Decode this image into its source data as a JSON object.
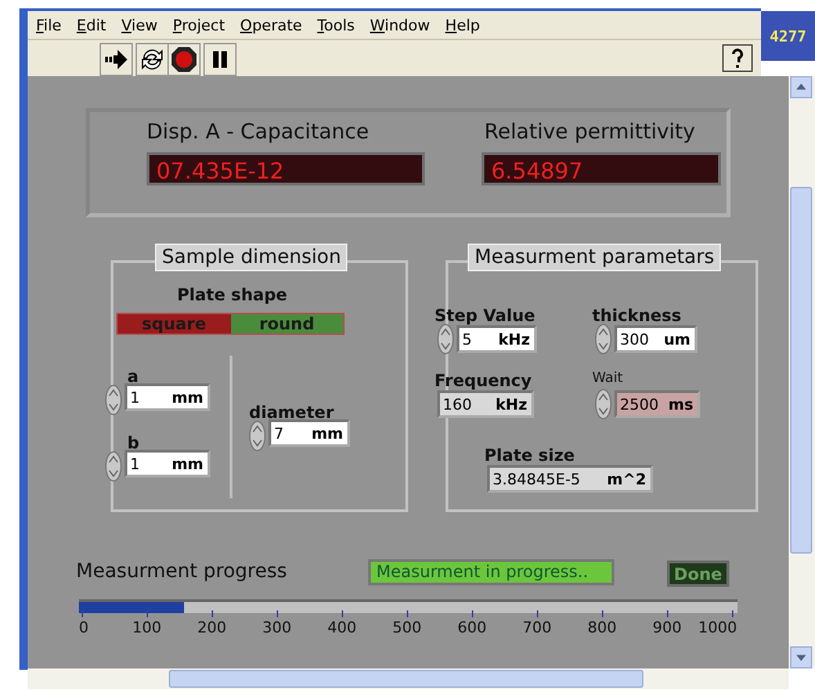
{
  "menu": [
    "File",
    "Edit",
    "View",
    "Project",
    "Operate",
    "Tools",
    "Window",
    "Help"
  ],
  "badge": "4277",
  "displays": [
    {
      "label": "Disp. A - Capacitance",
      "value": "07.435E-12"
    },
    {
      "label": "Relative permittivity",
      "value": "6.54897"
    }
  ],
  "sample_dimension": {
    "title": "Sample dimension",
    "plate_shape": {
      "label": "Plate shape",
      "options": [
        {
          "label": "square",
          "color": "#9a1c1c"
        },
        {
          "label": "round",
          "color": "#4a8c3c"
        }
      ]
    },
    "fields": [
      {
        "label": "a",
        "value": "1",
        "unit": "mm",
        "kind": "control",
        "color": "#ffffff"
      },
      {
        "label": "b",
        "value": "1",
        "unit": "mm",
        "kind": "control",
        "color": "#ffffff"
      },
      {
        "label": "diameter",
        "value": "7",
        "unit": "mm",
        "kind": "control",
        "color": "#ffffff"
      }
    ]
  },
  "measurement_parameters": {
    "title": "Measurment parametars",
    "fields": [
      {
        "label": "Step Value",
        "value": "5",
        "unit": "kHz",
        "kind": "control",
        "color": "#ffffff"
      },
      {
        "label": "thickness",
        "value": "300",
        "unit": "um",
        "kind": "control",
        "color": "#ffffff"
      },
      {
        "label": "Frequency",
        "value": "160",
        "unit": "kHz",
        "kind": "indicator",
        "color": "#d8d8d8"
      },
      {
        "label": "Wait",
        "value": "2500",
        "unit": "ms",
        "kind": "control",
        "color": "#c9a3a3"
      },
      {
        "label": "Plate size",
        "value": "3.84845E-5",
        "unit": "m^2",
        "kind": "indicator",
        "color": "#d8d8d8"
      }
    ]
  },
  "progress": {
    "label": "Measurment progress",
    "status": "Measurment in progress..",
    "done": {
      "label": "Done",
      "on": false
    },
    "level": 0.16,
    "ticks": [
      "0",
      "100",
      "200",
      "300",
      "400",
      "500",
      "600",
      "700",
      "800",
      "900",
      "1000"
    ]
  }
}
